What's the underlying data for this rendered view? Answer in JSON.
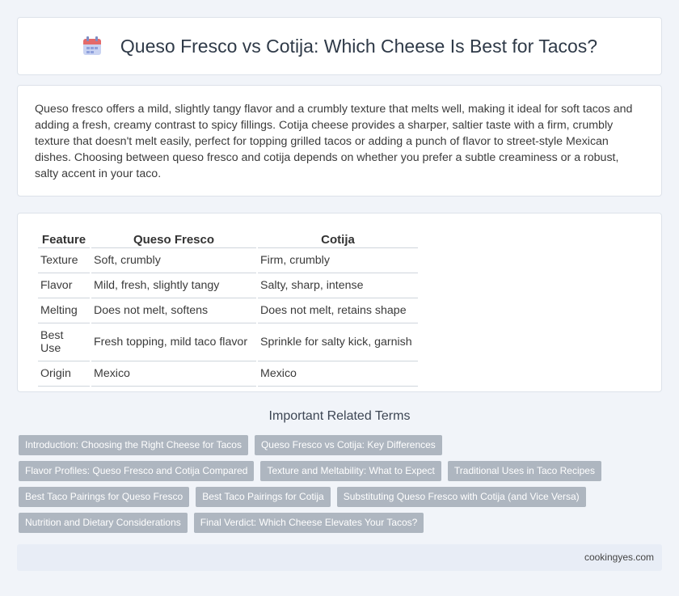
{
  "header": {
    "title": "Queso Fresco vs Cotija: Which Cheese Is Best for Tacos?",
    "icon": "calendar-icon"
  },
  "intro": {
    "text": "Queso fresco offers a mild, slightly tangy flavor and a crumbly texture that melts well, making it ideal for soft tacos and adding a fresh, creamy contrast to spicy fillings. Cotija cheese provides a sharper, saltier taste with a firm, crumbly texture that doesn't melt easily, perfect for topping grilled tacos or adding a punch of flavor to street-style Mexican dishes. Choosing between queso fresco and cotija depends on whether you prefer a subtle creaminess or a robust, salty accent in your taco."
  },
  "table": {
    "headers": [
      "Feature",
      "Queso Fresco",
      "Cotija"
    ],
    "rows": [
      [
        "Texture",
        "Soft, crumbly",
        "Firm, crumbly"
      ],
      [
        "Flavor",
        "Mild, fresh, slightly tangy",
        "Salty, sharp, intense"
      ],
      [
        "Melting",
        "Does not melt, softens",
        "Does not melt, retains shape"
      ],
      [
        "Best Use",
        "Fresh topping, mild taco flavor",
        "Sprinkle for salty kick, garnish"
      ],
      [
        "Origin",
        "Mexico",
        "Mexico"
      ]
    ]
  },
  "related": {
    "title": "Important Related Terms",
    "tags": [
      "Introduction: Choosing the Right Cheese for Tacos",
      "Queso Fresco vs Cotija: Key Differences",
      "Flavor Profiles: Queso Fresco and Cotija Compared",
      "Texture and Meltability: What to Expect",
      "Traditional Uses in Taco Recipes",
      "Best Taco Pairings for Queso Fresco",
      "Best Taco Pairings for Cotija",
      "Substituting Queso Fresco with Cotija (and Vice Versa)",
      "Nutrition and Dietary Considerations",
      "Final Verdict: Which Cheese Elevates Your Tacos?"
    ]
  },
  "footer": {
    "site": "cookingyes.com"
  },
  "colors": {
    "background": "#f1f4f9",
    "tag": "#aeb6c0",
    "footer": "#e8edf6"
  }
}
